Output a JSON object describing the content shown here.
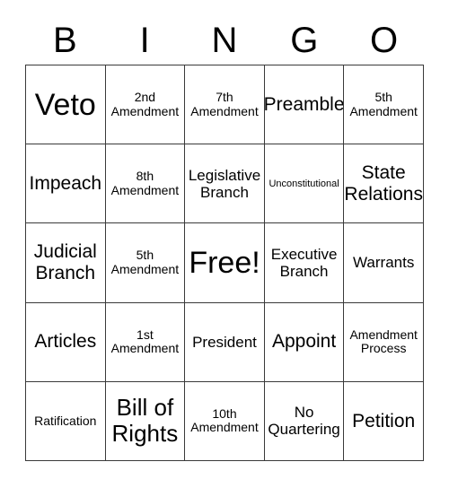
{
  "header": {
    "letters": [
      "B",
      "I",
      "N",
      "G",
      "O"
    ]
  },
  "grid": {
    "rows": 5,
    "columns": 5,
    "border_color": "#3a3a3a",
    "background_color": "#ffffff",
    "text_color": "#000000",
    "cells": [
      {
        "text": "Veto",
        "size": "sz-xxl"
      },
      {
        "text": "2nd\nAmendment",
        "size": "sz-sm"
      },
      {
        "text": "7th\nAmendment",
        "size": "sz-sm"
      },
      {
        "text": "Preamble",
        "size": "sz-lg"
      },
      {
        "text": "5th\nAmendment",
        "size": "sz-sm"
      },
      {
        "text": "Impeach",
        "size": "sz-lg"
      },
      {
        "text": "8th\nAmendment",
        "size": "sz-sm"
      },
      {
        "text": "Legislative\nBranch",
        "size": "sz-md"
      },
      {
        "text": "Unconstitutional",
        "size": "sz-xs"
      },
      {
        "text": "State\nRelations",
        "size": "sz-lg"
      },
      {
        "text": "Judicial\nBranch",
        "size": "sz-lg"
      },
      {
        "text": "5th\nAmendment",
        "size": "sz-sm"
      },
      {
        "text": "Free!",
        "size": "sz-xxl"
      },
      {
        "text": "Executive\nBranch",
        "size": "sz-md"
      },
      {
        "text": "Warrants",
        "size": "sz-md"
      },
      {
        "text": "Articles",
        "size": "sz-lg"
      },
      {
        "text": "1st\nAmendment",
        "size": "sz-sm"
      },
      {
        "text": "President",
        "size": "sz-md"
      },
      {
        "text": "Appoint",
        "size": "sz-lg"
      },
      {
        "text": "Amendment\nProcess",
        "size": "sz-sm"
      },
      {
        "text": "Ratification",
        "size": "sz-sm"
      },
      {
        "text": "Bill of\nRights",
        "size": "sz-xl"
      },
      {
        "text": "10th\nAmendment",
        "size": "sz-sm"
      },
      {
        "text": "No\nQuartering",
        "size": "sz-md"
      },
      {
        "text": "Petition",
        "size": "sz-lg"
      }
    ]
  }
}
